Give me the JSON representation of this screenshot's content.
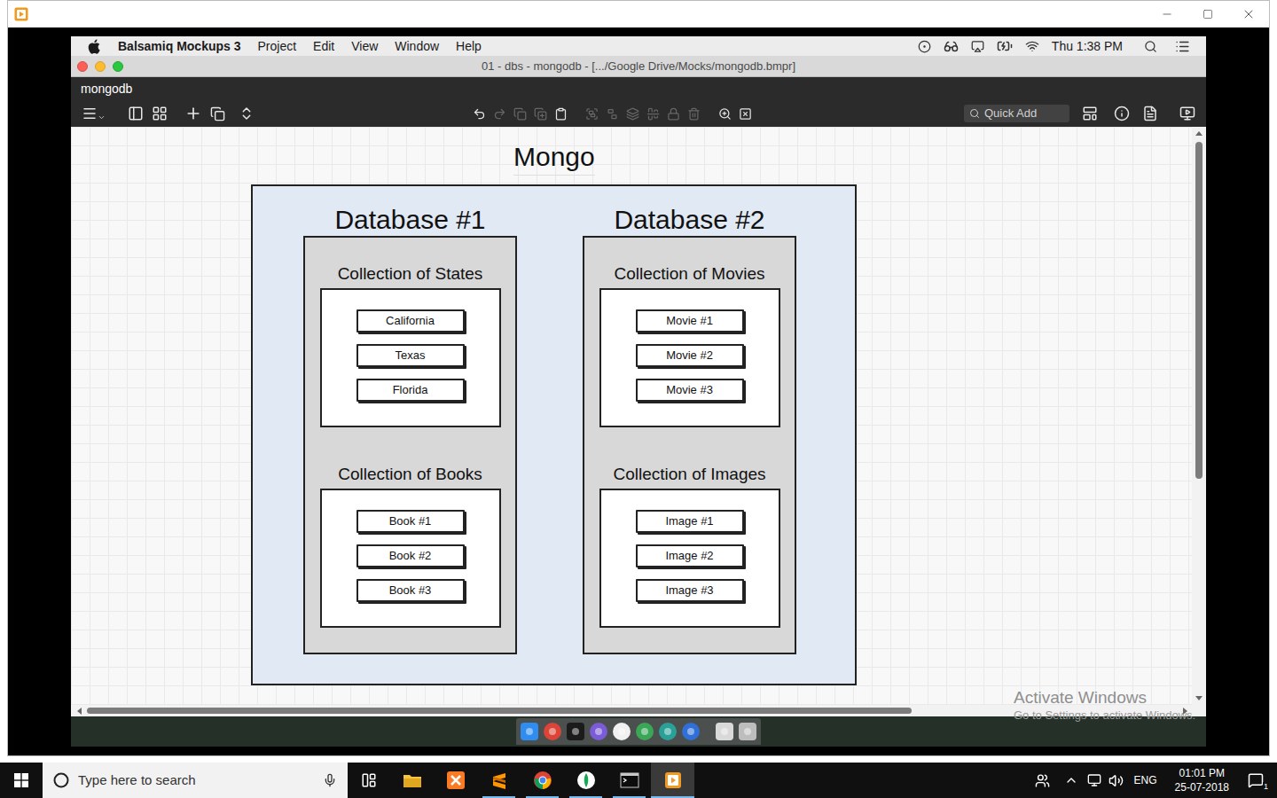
{
  "mac_menubar": {
    "app_name": "Balsamiq Mockups 3",
    "menus": [
      "Project",
      "Edit",
      "View",
      "Window",
      "Help"
    ],
    "clock": "Thu 1:38 PM"
  },
  "app_window": {
    "title": "01 - dbs - mongodb - [.../Google Drive/Mocks/mongodb.bmpr]",
    "project": "mongodb"
  },
  "toolbar": {
    "edit_tools": [
      {
        "disabled": false
      },
      {
        "disabled": true
      },
      {
        "disabled": true
      },
      {
        "disabled": true
      },
      {
        "disabled": false
      },
      {
        "disabled": true
      },
      {
        "disabled": true
      },
      {
        "disabled": true
      },
      {
        "disabled": true
      },
      {
        "disabled": true
      },
      {
        "disabled": true
      },
      {
        "disabled": false
      },
      {
        "disabled": false
      }
    ],
    "quick_add": {
      "placeholder": "Quick Add"
    }
  },
  "canvas": {
    "title": "Mongo",
    "databases": [
      {
        "name": "Database #1",
        "collections": [
          {
            "name": "Collection of States",
            "documents": [
              "California",
              "Texas",
              "Florida"
            ]
          },
          {
            "name": "Collection of Books",
            "documents": [
              "Book #1",
              "Book #2",
              "Book #3"
            ]
          }
        ]
      },
      {
        "name": "Database #2",
        "collections": [
          {
            "name": "Collection of Movies",
            "documents": [
              "Movie #1",
              "Movie #2",
              "Movie #3"
            ]
          },
          {
            "name": "Collection of Images",
            "documents": [
              "Image #1",
              "Image #2",
              "Image #3"
            ]
          }
        ]
      }
    ]
  },
  "watermark": {
    "title": "Activate Windows",
    "subtitle": "Go to Settings to activate Windows."
  },
  "taskbar": {
    "search": {
      "placeholder": "Type here to search"
    },
    "apps": [
      {
        "running": false,
        "selected": false
      },
      {
        "running": false,
        "selected": false
      },
      {
        "running": true,
        "selected": false
      },
      {
        "running": true,
        "selected": false
      },
      {
        "running": true,
        "selected": false
      },
      {
        "running": true,
        "selected": false
      },
      {
        "running": true,
        "selected": true
      }
    ],
    "language": "ENG",
    "time": "01:01 PM",
    "date": "25-07-2018",
    "notifications": "1"
  }
}
